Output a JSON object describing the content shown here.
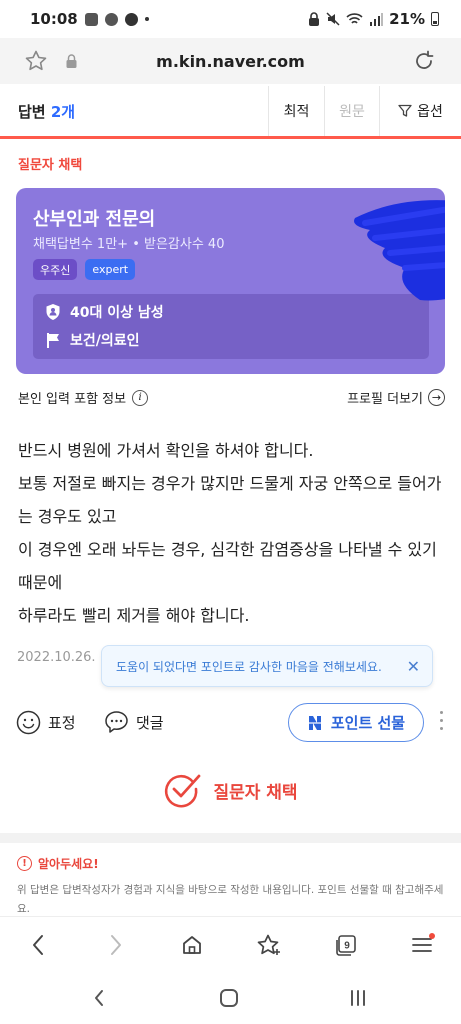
{
  "status_bar": {
    "time": "10:08",
    "battery": "21%"
  },
  "browser": {
    "url": "m.kin.naver.com"
  },
  "answer_header": {
    "title": "답변",
    "count": "2개",
    "tabs": [
      "최적",
      "원문",
      "옵션"
    ]
  },
  "chosen_label": "질문자 채택",
  "profile": {
    "name": "산부인과 전문의",
    "stats": "채택답변수 1만+ • 받은감사수 40",
    "badges": [
      "우주신",
      "expert"
    ],
    "info_rows": [
      "40대 이상 남성",
      "보건/의료인"
    ]
  },
  "input_info_label": "본인 입력 포함 정보",
  "profile_more_label": "프로필 더보기",
  "answer": {
    "lines": [
      "반드시 병원에 가셔서 확인을 하셔야 합니다.",
      "보통 저절로 빠지는 경우가 많지만 드물게 자궁 안쪽으로 들어가는 경우도 있고",
      "이 경우엔 오래 놔두는 경우, 심각한 감염증상을 나타낼 수 있기 때문에",
      "하루라도 빨리 제거를 해야 합니다."
    ],
    "date": "2022.10.26."
  },
  "tooltip": "도움이 되었다면 포인트로 감사한 마음을 전해보세요.",
  "actions": {
    "emotion": "표정",
    "comment": "댓글",
    "gift": "포인트 선물"
  },
  "select_answer": "질문자 채택",
  "notice": {
    "title": "알아두세요!",
    "text": "위 답변은 답변작성자가 경험과 지식을 바탕으로 작성한 내용입니다. 포인트 선물할 때 참고해주세요."
  },
  "browser_nav": {
    "tab_count": "9"
  },
  "colors": {
    "accent_red": "#e9473d",
    "card_purple": "#8b78dd",
    "link_blue": "#2e6bff"
  }
}
